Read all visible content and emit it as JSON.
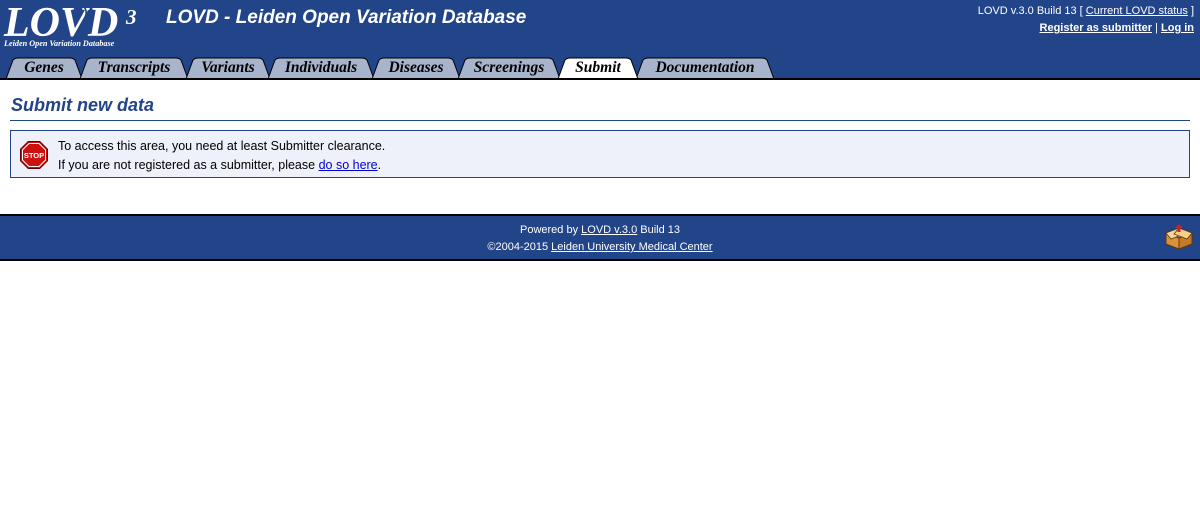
{
  "header": {
    "logo": {
      "text": "LOVD",
      "superscript": "3",
      "subtitle": "Leiden Open Variation Database"
    },
    "site_title": "LOVD - Leiden Open Variation Database",
    "version_text": "LOVD v.3.0 Build 13 [",
    "status_link": "Current LOVD status",
    "version_close": "]",
    "register_link": "Register as submitter",
    "separator": "|",
    "login_link": "Log in"
  },
  "tabs": [
    {
      "label": "Genes",
      "active": false
    },
    {
      "label": "Transcripts",
      "active": false
    },
    {
      "label": "Variants",
      "active": false
    },
    {
      "label": "Individuals",
      "active": false
    },
    {
      "label": "Diseases",
      "active": false
    },
    {
      "label": "Screenings",
      "active": false
    },
    {
      "label": "Submit",
      "active": true
    },
    {
      "label": "Documentation",
      "active": false
    }
  ],
  "main": {
    "title": "Submit new data",
    "message": {
      "icon": "stop-icon",
      "icon_text": "STOP",
      "line1": "To access this area, you need at least Submitter clearance.",
      "line2_prefix": "If you are not registered as a submitter, please ",
      "line2_link": "do so here",
      "line2_suffix": "."
    }
  },
  "footer": {
    "powered_prefix": "Powered by ",
    "powered_link": "LOVD v.3.0",
    "powered_suffix": " Build 13",
    "copyright_prefix": "©2004-2015 ",
    "copyright_link": "Leiden University Medical Center",
    "icon": "box-icon"
  },
  "colors": {
    "header_bg": "#224488",
    "tab_bg": "#A8B4CC",
    "tab_active_bg": "#FFFFFF",
    "message_bg": "#EEF0FA",
    "link": "#0000DD"
  }
}
